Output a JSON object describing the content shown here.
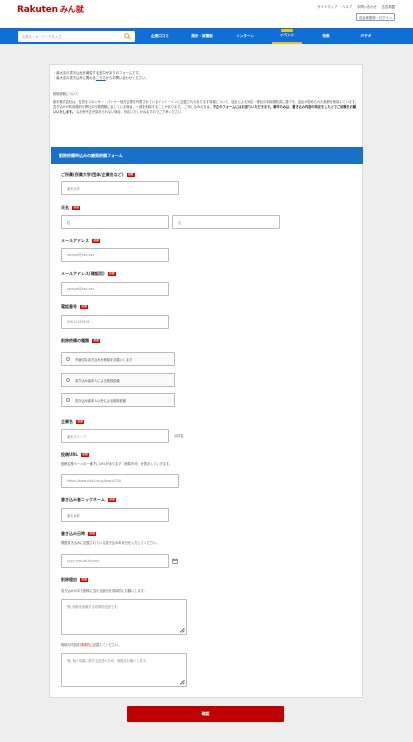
{
  "header": {
    "logo_brand": "Rakuten",
    "logo_service": "みん就",
    "toplinks": [
      "サイトマップ",
      "ヘルプ",
      "お問い合わせ",
      "広告掲載"
    ],
    "login_label": "自治体登録・ログイン",
    "search_placeholder": "企業名・キーワードを入力",
    "nav": [
      "企業口コミ",
      "掲示・就職案",
      "インターン",
      "イベント",
      "特集",
      "ITテギ"
    ],
    "nav_badge": "NEW"
  },
  "notes": {
    "line1": "・最大名の書き込みを報告する窓口がありのフォームです。",
    "line2_prefix": "・最大名の書き込みに関わる",
    "line2_link": "こちら",
    "line2_suffix": "からお問い合わせください。"
  },
  "notice": {
    "title": "削除依頼について",
    "body1": "楽天株式会社は、社員をスポンサー・パトナー他方企業を代表されているイントーインに記載されたあります情報について、違反による対応・弊社の利用規約書に基づき、",
    "body2": "違反が認められた投稿を削除しています。書き込みが利用規約や弊社の行動規範に反している場合、一部を削除することがあります。",
    "body3": "ご申し込みの方は、",
    "body3_bold": "不正のフォームにはお送りいただきます。事件のみは、書き込み内容の特定をした上でご依頼をお願いいたします。",
    "body4": "なお他不正が認められない場合、対応いたしかねますのでご了承ください。"
  },
  "form": {
    "title": "削除依頼申込みの開発依頼フォーム",
    "req_label": "必須",
    "company": {
      "label": "ご所属(所属大学/団体/企業名など)",
      "placeholder": "楽天大学"
    },
    "name": {
      "label": "氏名",
      "last_placeholder": "姓",
      "first_placeholder": "名"
    },
    "email": {
      "label": "メールアドレス",
      "placeholder": "sample@xxx.xxx"
    },
    "email_confirm": {
      "label": "メールアドレス(確認用)",
      "placeholder": "sample@xxx.xxx"
    },
    "phone": {
      "label": "電話番号",
      "placeholder": "09012345678"
    },
    "request_type": {
      "label": "削除依頼の種類",
      "options": [
        "不適切な書き込みを削除をお願いします",
        "書き込み者本人による削除依頼",
        "書き込み者本人以外による削除依頼"
      ]
    },
    "company_name": {
      "label": "企業名",
      "placeholder": "楽天グループ",
      "unit": "の件名"
    },
    "url": {
      "label": "投稿URL",
      "help": "投稿企業ページの一番下にURLがあります（削除不可）を表示していきます。",
      "placeholder": "https://www.nikki.ne.jp/board/7XX"
    },
    "nickname": {
      "label": "書き込み者ニックネーム",
      "placeholder": "楽天太郎"
    },
    "date": {
      "label": "書き込み日時",
      "help": "問題書き込みに記載されている書き込み年月日を入力してください。",
      "placeholder": "yyyy-mm-dd hh:mm"
    },
    "reason": {
      "label": "削除理由",
      "help1": "書き込みの中で削除に当たる部分を具体的にお願いします。",
      "placeholder1": "例) 削除を依頼する具体的記述です。",
      "help2_prefix": "削除の内容を",
      "help2_highlight": "具体的",
      "help2_suffix": "に記載してください。",
      "placeholder2": "例) 個人情報に関する記述のため、削除をお願いします。"
    },
    "submit_label": "確認"
  }
}
